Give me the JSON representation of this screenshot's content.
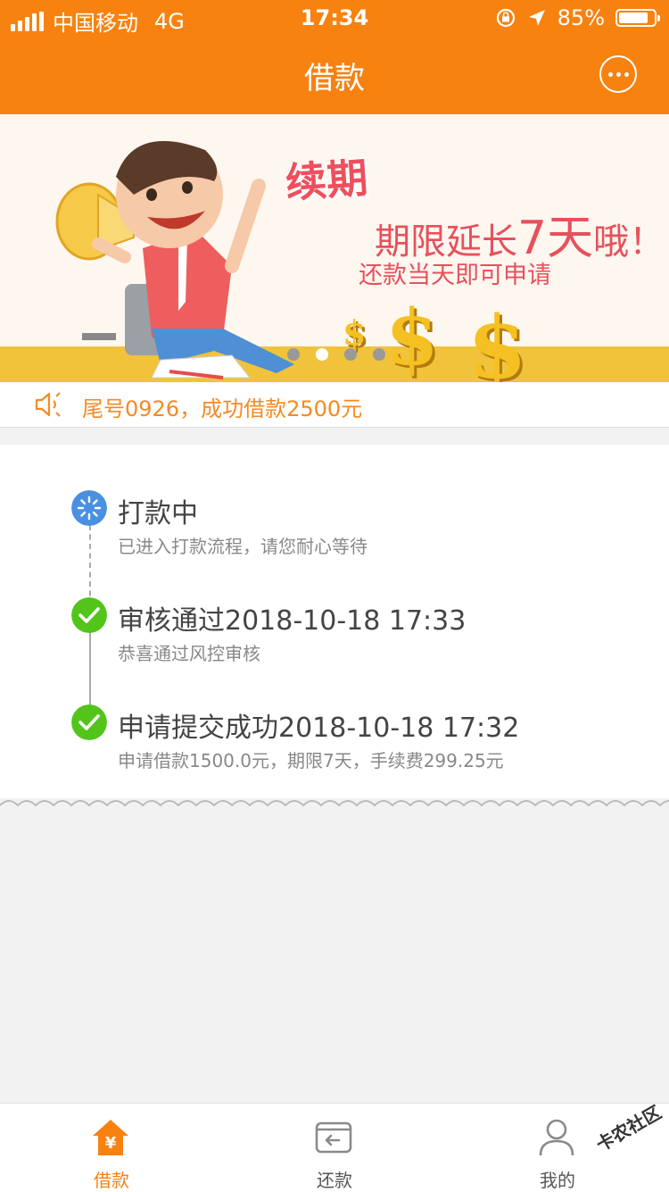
{
  "status_bar": {
    "carrier": "中国移动",
    "network": "4G",
    "time": "17:34",
    "battery": "85%",
    "battery_level": 0.85
  },
  "nav": {
    "title": "借款",
    "more_icon": "more-dots-icon"
  },
  "banner": {
    "headline": "续期",
    "line1_prefix": "期限延长",
    "line1_highlight": "7天",
    "line1_suffix": "哦！",
    "line2": "还款当天即可申请",
    "dollar_glyph": "$",
    "page_count": 4,
    "active_page": 2
  },
  "notice": {
    "text": "尾号0926，成功借款2500元",
    "icon": "speaker-icon"
  },
  "steps": [
    {
      "title": "打款中",
      "desc": "已进入打款流程，请您耐心等待",
      "status": "processing"
    },
    {
      "title": "审核通过2018-10-18 17:33",
      "desc": "恭喜通过风控审核",
      "status": "done"
    },
    {
      "title": "申请提交成功2018-10-18 17:32",
      "desc": "申请借款1500.0元，期限7天，手续费299.25元",
      "status": "done"
    }
  ],
  "tabbar": [
    {
      "label": "借款",
      "icon": "home-yen-icon",
      "active": true
    },
    {
      "label": "还款",
      "icon": "repay-card-icon",
      "active": false
    },
    {
      "label": "我的",
      "icon": "user-icon",
      "active": false
    }
  ],
  "watermark": "卡农社区",
  "colors": {
    "brand": "#f7820f",
    "success": "#52c41a",
    "processing": "#4a90e2",
    "notice": "#f58a23",
    "banner_red": "#e8505b"
  }
}
